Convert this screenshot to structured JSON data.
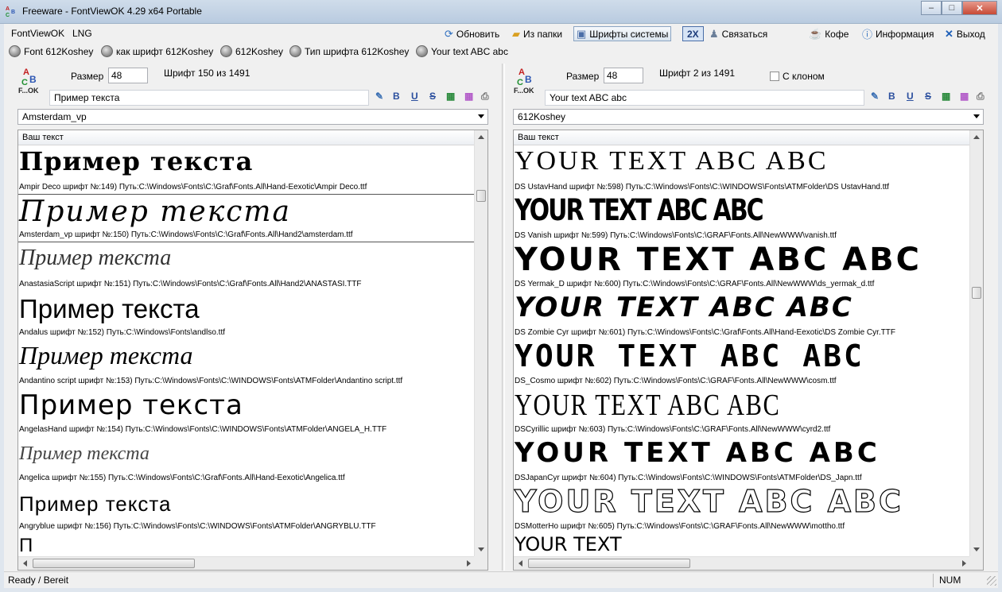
{
  "window": {
    "title": "Freeware - FontViewOK 4.29 x64 Portable",
    "minimize": "–",
    "maximize": "□",
    "close": "✕"
  },
  "menu": {
    "app": "FontViewOK",
    "lng": "LNG"
  },
  "toolbar": {
    "refresh": "Обновить",
    "from_folder": "Из папки",
    "system_fonts": "Шрифты системы",
    "two_x": "2X",
    "contact": "Связаться",
    "coffee": "Кофе",
    "info": "Информация",
    "exit": "Выход"
  },
  "favorites": [
    "Font 612Koshey",
    "как шрифт 612Koshey",
    "612Koshey",
    "Тип шрифта 612Koshey",
    "Your text ABC abc"
  ],
  "left_panel": {
    "logo": {
      "a": "A",
      "b": "B",
      "c": "C",
      "ok": "F...OK"
    },
    "size_label": "Размер",
    "size_value": "48",
    "font_count": "Шрифт 150 из 1491",
    "sample_text": "Пример текста",
    "format_buttons": [
      "B",
      "U",
      "S"
    ],
    "selected_font": "Amsterdam_vp",
    "list_header": "Ваш текст",
    "scroll_value": 0.12,
    "rows": [
      {
        "sample": "Пример текста",
        "info": "Ampir Deco шрифт №:149) Путь:C:\\Windows\\Fonts\\C:\\Graf\\Fonts.All\\Hand-Eexotic\\Ampir Deco.ttf"
      },
      {
        "sample": "Пример   текста",
        "info": "Amsterdam_vp шрифт №:150) Путь:C:\\Windows\\Fonts\\C:\\Graf\\Fonts.All\\Hand2\\amsterdam.ttf"
      },
      {
        "sample": "Пример текста",
        "info": "AnastasiaScript шрифт №:151) Путь:C:\\Windows\\Fonts\\C:\\Graf\\Fonts.All\\Hand2\\ANASTASI.TTF"
      },
      {
        "sample": "Пример текста",
        "info": "Andalus шрифт №:152) Путь:C:\\Windows\\Fonts\\andlso.ttf"
      },
      {
        "sample": "Пример текста",
        "info": "Andantino script шрифт №:153) Путь:C:\\Windows\\Fonts\\C:\\WINDOWS\\Fonts\\ATMFolder\\Andantino script.ttf"
      },
      {
        "sample": "Пример  текста",
        "info": "AngelasHand шрифт №:154) Путь:C:\\Windows\\Fonts\\C:\\WINDOWS\\Fonts\\ATMFolder\\ANGELA_H.TTF"
      },
      {
        "sample": "Пример текста",
        "info": "Angelica шрифт №:155) Путь:C:\\Windows\\Fonts\\C:\\Graf\\Fonts.All\\Hand-Eexotic\\Angelica.ttf"
      },
      {
        "sample": "Пример  текста",
        "info": "Angryblue шрифт №:156) Путь:C:\\Windows\\Fonts\\C:\\WINDOWS\\Fonts\\ATMFolder\\ANGRYBLU.TTF"
      },
      {
        "sample": "П",
        "info": ""
      }
    ]
  },
  "right_panel": {
    "logo": {
      "a": "A",
      "b": "B",
      "c": "C",
      "ok": "F...OK"
    },
    "size_label": "Размер",
    "size_value": "48",
    "font_count": "Шрифт 2 из 1491",
    "clone_label": "С клоном",
    "clone_checked": false,
    "sample_text": "Your text ABC abc",
    "format_buttons": [
      "B",
      "U",
      "S"
    ],
    "selected_font": "612Koshey",
    "list_header": "Ваш текст",
    "scroll_value": 0.37,
    "rows": [
      {
        "sample": "YOUR TEXT ABC ABC",
        "info": "DS UstavHand шрифт №:598) Путь:C:\\Windows\\Fonts\\C:\\WINDOWS\\Fonts\\ATMFolder\\DS UstavHand.ttf"
      },
      {
        "sample": "YOUR TEXT ABC ABC",
        "info": "DS Vanish шрифт №:599) Путь:C:\\Windows\\Fonts\\C:\\GRAF\\Fonts.All\\NewWWW\\vanish.ttf"
      },
      {
        "sample": "YOUR TEXT ABC ABC",
        "info": "DS Yermak_D шрифт №:600) Путь:C:\\Windows\\Fonts\\C:\\GRAF\\Fonts.All\\NewWWW\\ds_yermak_d.ttf"
      },
      {
        "sample": "YOUR TEXT ABC ABC",
        "info": "DS Zombie Cyr шрифт №:601) Путь:C:\\Windows\\Fonts\\C:\\Graf\\Fonts.All\\Hand-Eexotic\\DS Zombie Cyr.TTF"
      },
      {
        "sample": "YOUR TEXT ABC ABC",
        "info": "DS_Cosmo шрифт №:602) Путь:C:\\Windows\\Fonts\\C:\\GRAF\\Fonts.All\\NewWWW\\cosm.ttf"
      },
      {
        "sample": "YOUR TEXT ABC ABC",
        "info": "DSCyrillic шрифт №:603) Путь:C:\\Windows\\Fonts\\C:\\GRAF\\Fonts.All\\NewWWW\\cyrd2.ttf"
      },
      {
        "sample": "YOUR TEXT ABC ABC",
        "info": "DSJapanCyr шрифт №:604) Путь:C:\\Windows\\Fonts\\C:\\WINDOWS\\Fonts\\ATMFolder\\DS_Japn.ttf"
      },
      {
        "sample": "YOUR TEXT ABC ABC",
        "info": "DSMotterHo шрифт №:605) Путь:C:\\Windows\\Fonts\\C:\\GRAF\\Fonts.All\\NewWWW\\mottho.ttf"
      },
      {
        "sample": "YOUR TEXT",
        "info": ""
      }
    ]
  },
  "status": {
    "text": "Ready / Bereit",
    "num": "NUM"
  },
  "icons": {
    "refresh": "refresh-icon",
    "folder": "folder-icon",
    "system": "system-fonts-icon",
    "contact": "contact-icon",
    "coffee": "coffee-icon",
    "info": "info-icon",
    "exit": "exit-icon"
  },
  "colors": {
    "accent": "#2b4f9e",
    "close": "#c74a36"
  }
}
